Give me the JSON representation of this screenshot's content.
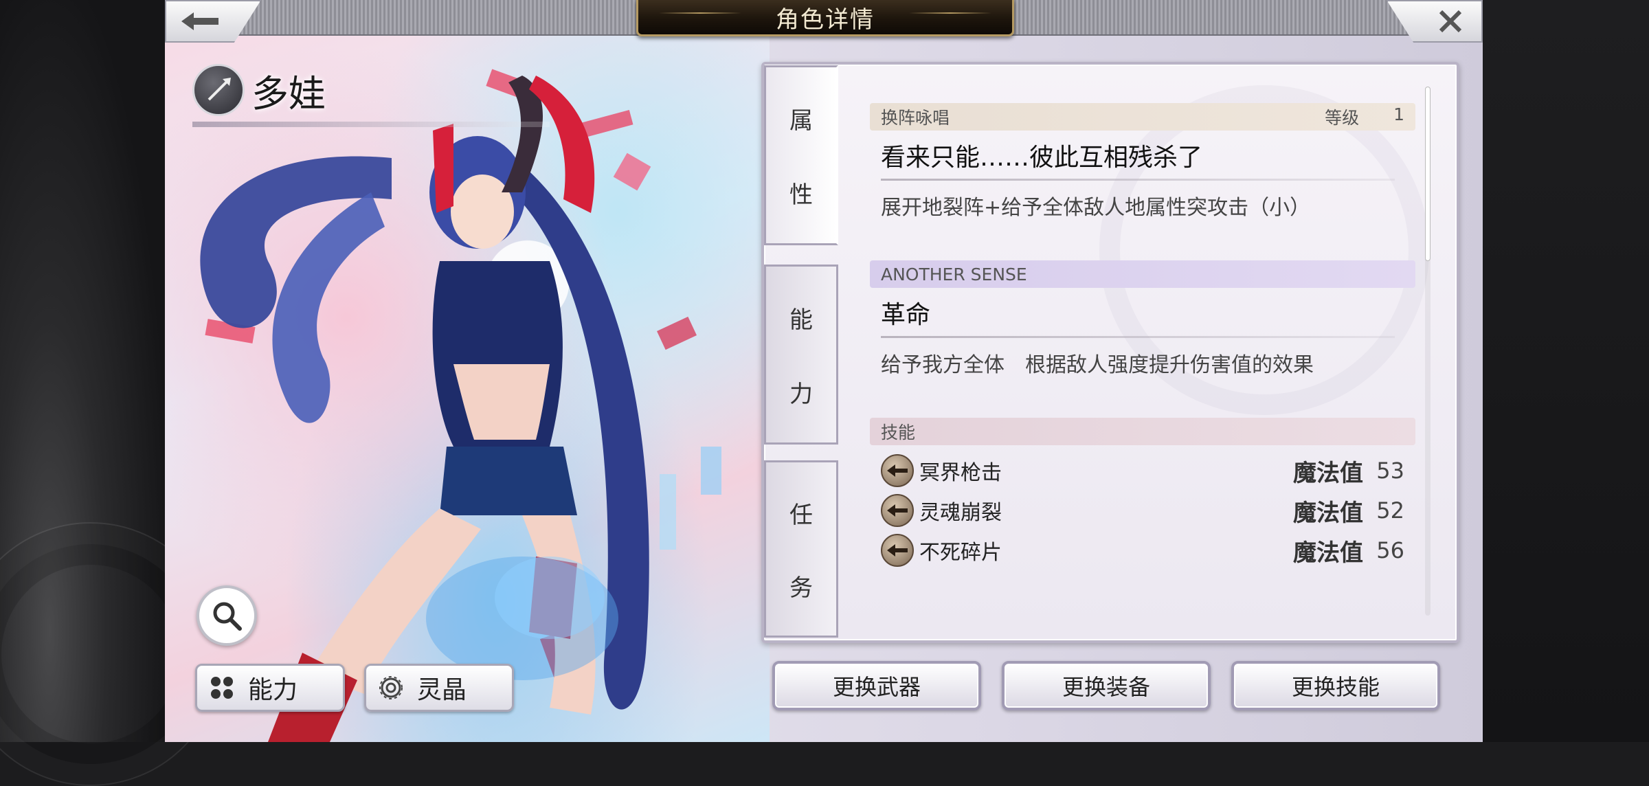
{
  "header": {
    "title": "角色详情",
    "back_icon": "arrow-left-icon",
    "close_icon": "close-icon"
  },
  "character": {
    "name": "多娃",
    "class_icon": "spear-class-icon"
  },
  "left_buttons": {
    "ability_label": "能力",
    "crystal_label": "灵晶"
  },
  "tabs": [
    {
      "label_top": "属",
      "label_bottom": "性",
      "active": true
    },
    {
      "label_top": "能",
      "label_bottom": "力",
      "active": false
    },
    {
      "label_top": "任",
      "label_bottom": "务",
      "active": false
    }
  ],
  "formation_chant": {
    "header": "换阵咏唱",
    "level_label": "等级",
    "level_value": "1",
    "name": "看来只能……彼此互相残杀了",
    "description": "展开地裂阵+给予全体敌人地属性突攻击（小）"
  },
  "another_sense": {
    "header": "ANOTHER SENSE",
    "name": "革命",
    "description": "给予我方全体　根据敌人强度提升伤害值的效果"
  },
  "skills": {
    "header": "技能",
    "mp_label": "魔法值",
    "items": [
      {
        "name": "冥界枪击",
        "mp": "53",
        "icon": "spear-skill-icon"
      },
      {
        "name": "灵魂崩裂",
        "mp": "52",
        "icon": "spear-skill-icon"
      },
      {
        "name": "不死碎片",
        "mp": "56",
        "icon": "spear-skill-icon"
      }
    ]
  },
  "actions": {
    "change_weapon": "更换武器",
    "change_equipment": "更换装备",
    "change_skill": "更换技能"
  },
  "colors": {
    "title_plate": "#1d150c",
    "title_border": "#b59a62",
    "panel_bg": "#f2eff6",
    "formation_bar": "#e9dfd4",
    "another_sense_bar": "#d7cdec",
    "skills_bar": "#e4d2da"
  }
}
